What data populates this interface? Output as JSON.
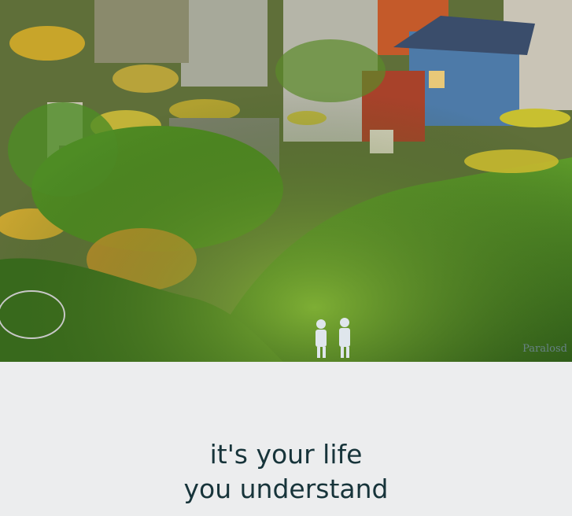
{
  "hero": {
    "watermark": "Paralosd"
  },
  "caption": {
    "line1": "it's your life",
    "line2": "you understand"
  }
}
